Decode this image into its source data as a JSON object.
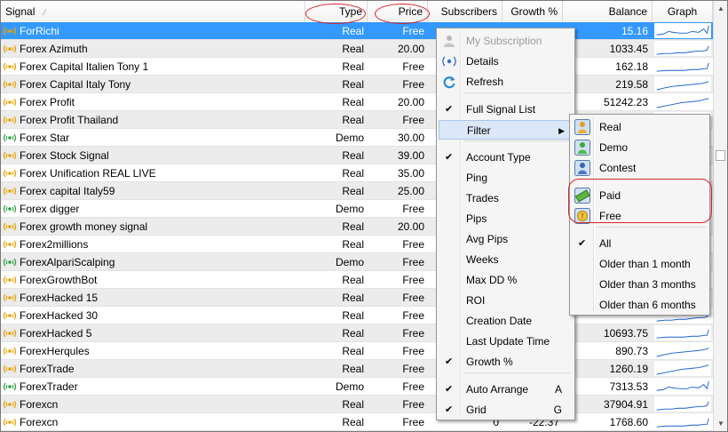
{
  "header": {
    "signal": "Signal",
    "type": "Type",
    "price": "Price",
    "subscribers": "Subscribers",
    "growth": "Growth %",
    "balance": "Balance",
    "graph": "Graph",
    "sort_mark": "⁄"
  },
  "rows": [
    {
      "name": "ForRichi",
      "type": "Real",
      "price": "Free",
      "subs": "",
      "growth": "",
      "balance": "15.16",
      "icon": "signal-red-icon"
    },
    {
      "name": "Forex Azimuth",
      "type": "Real",
      "price": "20.00",
      "subs": "",
      "growth": "",
      "balance": "1033.45",
      "icon": "signal-red-icon"
    },
    {
      "name": "Forex Capital Italien Tony 1",
      "type": "Real",
      "price": "Free",
      "subs": "",
      "growth": "",
      "balance": "162.18",
      "icon": "signal-red-icon"
    },
    {
      "name": "Forex Capital Italy Tony",
      "type": "Real",
      "price": "Free",
      "subs": "",
      "growth": "",
      "balance": "219.58",
      "icon": "signal-red-icon"
    },
    {
      "name": "Forex Profit",
      "type": "Real",
      "price": "20.00",
      "subs": "",
      "growth": "",
      "balance": "51242.23",
      "icon": "signal-red-icon"
    },
    {
      "name": "Forex Profit Thailand",
      "type": "Real",
      "price": "Free",
      "subs": "",
      "growth": "",
      "balance": "",
      "icon": "signal-red-icon"
    },
    {
      "name": "Forex Star",
      "type": "Demo",
      "price": "30.00",
      "subs": "",
      "growth": "",
      "balance": "",
      "icon": "signal-green-icon"
    },
    {
      "name": "Forex Stock Signal",
      "type": "Real",
      "price": "39.00",
      "subs": "",
      "growth": "",
      "balance": "",
      "icon": "signal-red-icon"
    },
    {
      "name": "Forex Unification REAL LIVE",
      "type": "Real",
      "price": "35.00",
      "subs": "",
      "growth": "",
      "balance": "",
      "icon": "signal-red-icon"
    },
    {
      "name": "Forex capital Italy59",
      "type": "Real",
      "price": "25.00",
      "subs": "",
      "growth": "",
      "balance": "",
      "icon": "signal-red-icon"
    },
    {
      "name": "Forex digger",
      "type": "Demo",
      "price": "Free",
      "subs": "",
      "growth": "",
      "balance": "",
      "icon": "signal-green-icon"
    },
    {
      "name": "Forex growth money signal",
      "type": "Real",
      "price": "20.00",
      "subs": "",
      "growth": "",
      "balance": "",
      "icon": "signal-red-icon"
    },
    {
      "name": "Forex2millions",
      "type": "Real",
      "price": "Free",
      "subs": "",
      "growth": "",
      "balance": "",
      "icon": "signal-red-icon"
    },
    {
      "name": "ForexAlpariScalping",
      "type": "Demo",
      "price": "Free",
      "subs": "",
      "growth": "",
      "balance": "",
      "icon": "signal-green-icon"
    },
    {
      "name": "ForexGrowthBot",
      "type": "Real",
      "price": "Free",
      "subs": "",
      "growth": "",
      "balance": "",
      "icon": "signal-red-icon"
    },
    {
      "name": "ForexHacked 15",
      "type": "Real",
      "price": "Free",
      "subs": "",
      "growth": "",
      "balance": "",
      "icon": "signal-red-icon"
    },
    {
      "name": "ForexHacked 30",
      "type": "Real",
      "price": "Free",
      "subs": "",
      "growth": "",
      "balance": "",
      "icon": "signal-red-icon"
    },
    {
      "name": "ForexHacked 5",
      "type": "Real",
      "price": "Free",
      "subs": "",
      "growth": "",
      "balance": "10693.75",
      "icon": "signal-red-icon"
    },
    {
      "name": "ForexHerqules",
      "type": "Real",
      "price": "Free",
      "subs": "",
      "growth": "",
      "balance": "890.73",
      "icon": "signal-red-icon"
    },
    {
      "name": "ForexTrade",
      "type": "Real",
      "price": "Free",
      "subs": "",
      "growth": "",
      "balance": "1260.19",
      "icon": "signal-red-icon"
    },
    {
      "name": "ForexTrader",
      "type": "Demo",
      "price": "Free",
      "subs": "",
      "growth": "",
      "balance": "7313.53",
      "icon": "signal-green-icon"
    },
    {
      "name": "Forexcn",
      "type": "Real",
      "price": "Free",
      "subs": "",
      "growth": "",
      "balance": "37904.91",
      "icon": "signal-red-icon"
    },
    {
      "name": "Forexcn",
      "type": "Real",
      "price": "Free",
      "subs": "0",
      "growth": "-22.37",
      "balance": "1768.60",
      "icon": "signal-red-icon"
    }
  ],
  "context_menu": {
    "items": [
      {
        "label": "My Subscription",
        "disabled": true,
        "icon": "subscription-icon"
      },
      {
        "label": "Details",
        "icon": "details-icon"
      },
      {
        "label": "Refresh",
        "icon": "refresh-icon"
      },
      {
        "label": "Full Signal List",
        "checked": true
      },
      {
        "label": "Filter",
        "submenu": true,
        "highlighted": true
      },
      {
        "label": "Account Type",
        "checked": true
      },
      {
        "label": "Ping"
      },
      {
        "label": "Trades"
      },
      {
        "label": "Pips"
      },
      {
        "label": "Avg Pips"
      },
      {
        "label": "Weeks"
      },
      {
        "label": "Max DD %"
      },
      {
        "label": "ROI"
      },
      {
        "label": "Creation Date"
      },
      {
        "label": "Last Update Time"
      },
      {
        "label": "Growth %",
        "checked": true
      },
      {
        "label": "Auto Arrange",
        "checked": true,
        "accel": "A"
      },
      {
        "label": "Grid",
        "checked": true,
        "accel": "G"
      }
    ],
    "check_mark": "✔",
    "submenu_arrow": "▶"
  },
  "filter_submenu": {
    "items": [
      {
        "label": "Real",
        "icon": "real-account-icon"
      },
      {
        "label": "Demo",
        "icon": "demo-account-icon"
      },
      {
        "label": "Contest",
        "icon": "contest-account-icon"
      },
      {
        "label": "Paid",
        "icon": "paid-icon"
      },
      {
        "label": "Free",
        "icon": "free-icon"
      },
      {
        "label": "All",
        "checked": true
      },
      {
        "label": "Older than 1 month"
      },
      {
        "label": "Older than 3 months"
      },
      {
        "label": "Older than 6 months"
      }
    ]
  },
  "colors": {
    "selection": "#3399ff",
    "annotation": "#d6232a",
    "sparkline": "#1a5fd0"
  }
}
